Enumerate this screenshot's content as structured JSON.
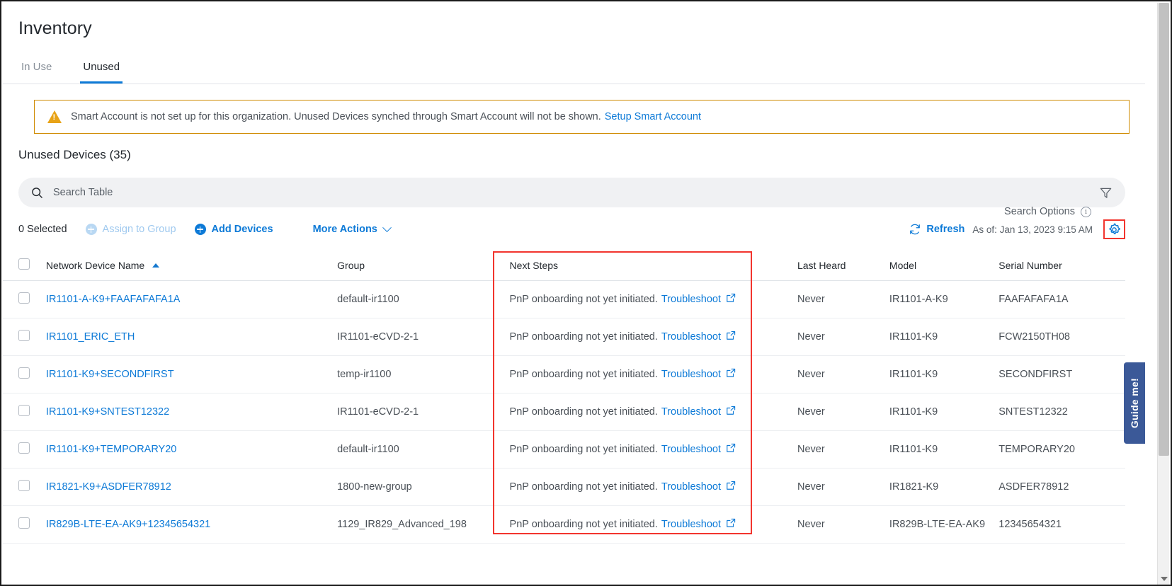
{
  "header": {
    "title": "Inventory",
    "tabs": [
      {
        "label": "In Use",
        "active": false
      },
      {
        "label": "Unused",
        "active": true
      }
    ]
  },
  "banner": {
    "icon": "warning-triangle-icon",
    "message": "Smart Account is not set up for this organization. Unused Devices synched through Smart Account will not be shown.",
    "link_label": "Setup Smart Account",
    "border_color": "#cf8a00",
    "icon_color": "#e8a317"
  },
  "section": {
    "title": "Unused Devices (35)"
  },
  "search": {
    "placeholder": "Search Table",
    "icon": "search-icon",
    "filter_icon": "filter-funnel-icon"
  },
  "toolbar": {
    "selected_label": "0 Selected",
    "assign_to_group_label": "Assign to Group",
    "add_devices_label": "Add Devices",
    "more_actions_label": "More Actions",
    "search_options_label": "Search Options",
    "refresh_label": "Refresh",
    "as_of_label": "As of: Jan 13, 2023 9:15 AM",
    "gear_icon": "gear-icon",
    "accent_color": "#0d7ad7",
    "highlight_color": "#f2352e"
  },
  "table": {
    "columns": [
      {
        "key": "name",
        "label": "Network Device Name",
        "sorted": "asc"
      },
      {
        "key": "group",
        "label": "Group"
      },
      {
        "key": "next",
        "label": "Next Steps"
      },
      {
        "key": "heard",
        "label": "Last Heard"
      },
      {
        "key": "model",
        "label": "Model"
      },
      {
        "key": "serial",
        "label": "Serial Number"
      }
    ],
    "next_steps_text": "PnP onboarding not yet initiated.",
    "troubleshoot_label": "Troubleshoot",
    "rows": [
      {
        "name": "IR1101-A-K9+FAAFAFAFA1A",
        "group": "default-ir1100",
        "heard": "Never",
        "model": "IR1101-A-K9",
        "serial": "FAAFAFAFA1A"
      },
      {
        "name": "IR1101_ERIC_ETH",
        "group": "IR1101-eCVD-2-1",
        "heard": "Never",
        "model": "IR1101-K9",
        "serial": "FCW2150TH08"
      },
      {
        "name": "IR1101-K9+SECONDFIRST",
        "group": "temp-ir1100",
        "heard": "Never",
        "model": "IR1101-K9",
        "serial": "SECONDFIRST"
      },
      {
        "name": "IR1101-K9+SNTEST12322",
        "group": "IR1101-eCVD-2-1",
        "heard": "Never",
        "model": "IR1101-K9",
        "serial": "SNTEST12322"
      },
      {
        "name": "IR1101-K9+TEMPORARY20",
        "group": "default-ir1100",
        "heard": "Never",
        "model": "IR1101-K9",
        "serial": "TEMPORARY20"
      },
      {
        "name": "IR1821-K9+ASDFER78912",
        "group": "1800-new-group",
        "heard": "Never",
        "model": "IR1821-K9",
        "serial": "ASDFER78912"
      },
      {
        "name": "IR829B-LTE-EA-AK9+12345654321",
        "group": "1129_IR829_Advanced_198",
        "heard": "Never",
        "model": "IR829B-LTE-EA-AK9",
        "serial": "12345654321"
      }
    ]
  },
  "guide_me": {
    "label": "Guide me!",
    "color": "#3b5998"
  }
}
